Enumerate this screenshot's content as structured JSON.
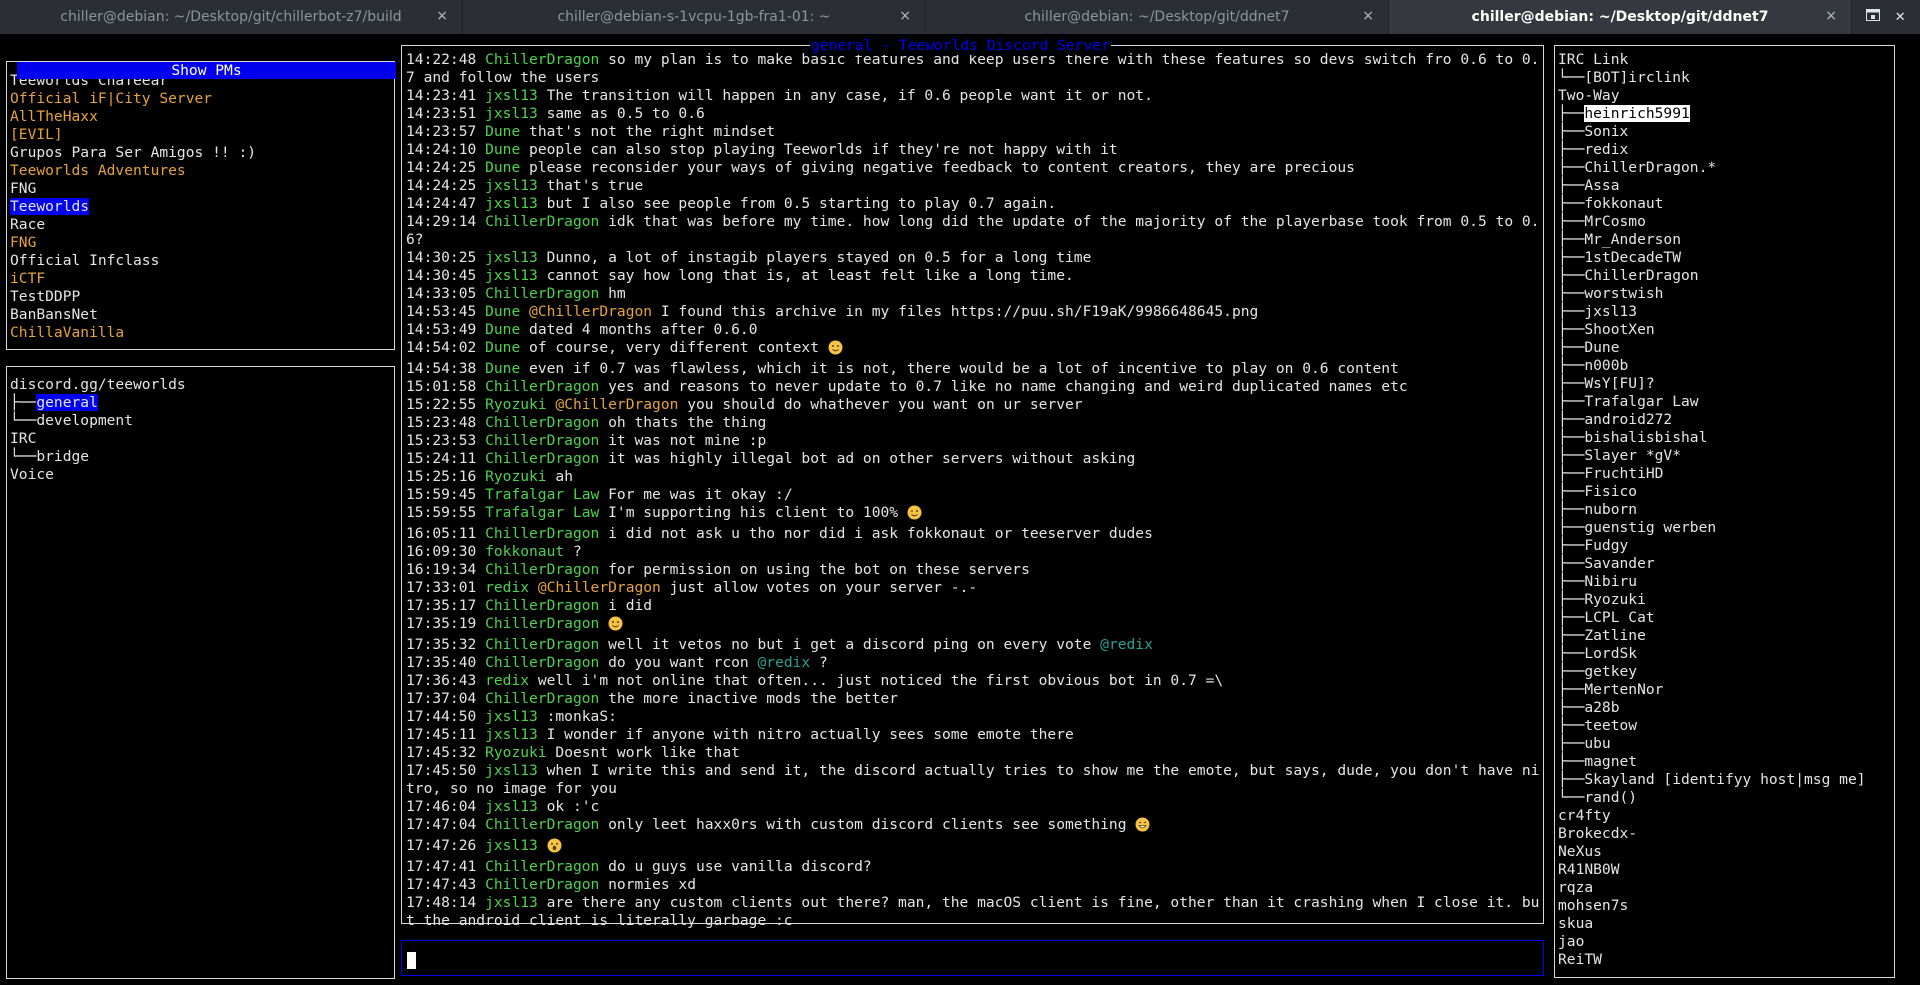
{
  "tabs": [
    {
      "title": "chiller@debian: ~/Desktop/git/chillerbot-z7/build",
      "active": false
    },
    {
      "title": "chiller@debian-s-1vcpu-1gb-fra1-01: ~",
      "active": false
    },
    {
      "title": "chiller@debian: ~/Desktop/git/ddnet7",
      "active": false
    },
    {
      "title": "chiller@debian: ~/Desktop/git/ddnet7",
      "active": true
    }
  ],
  "tab_close_glyph": "×",
  "tab_tools": {
    "new_tab_icon": "new-tab-icon",
    "menu_icon": "menu-icon",
    "close_glyph": "✕"
  },
  "servers": {
    "show_pms_label": "Show PMs",
    "items": [
      {
        "name": "Teeworlds ChaTeear",
        "color": "#e5e5e5"
      },
      {
        "name": "Official iF|City Server",
        "color": "#e6a23c"
      },
      {
        "name": "AllTheHaxx",
        "color": "#e6a23c"
      },
      {
        "name": "[EVIL]",
        "color": "#e6a23c"
      },
      {
        "name": "Grupos Para Ser Amigos !! :)",
        "color": "#e5e5e5"
      },
      {
        "name": "Teeworlds Adventures",
        "color": "#e6a23c"
      },
      {
        "name": "FNG",
        "color": "#e5e5e5"
      },
      {
        "name": "Teeworlds",
        "color": "#0000ee",
        "selected": true
      },
      {
        "name": "Race",
        "color": "#e5e5e5"
      },
      {
        "name": "FNG",
        "color": "#e6a23c"
      },
      {
        "name": "Official Infclass",
        "color": "#e5e5e5"
      },
      {
        "name": "iCTF",
        "color": "#e6a23c"
      },
      {
        "name": "TestDDPP",
        "color": "#e5e5e5"
      },
      {
        "name": "BanBansNet",
        "color": "#e5e5e5"
      },
      {
        "name": "ChillaVanilla",
        "color": "#e6a23c"
      }
    ]
  },
  "channels": {
    "lines": [
      {
        "prefix": "",
        "text": "discord.gg/teeworlds",
        "selected": false
      },
      {
        "prefix": "├──",
        "text": "general",
        "selected": true
      },
      {
        "prefix": "└──",
        "text": "development",
        "selected": false
      },
      {
        "prefix": "",
        "text": "IRC",
        "selected": false
      },
      {
        "prefix": "└──",
        "text": "bridge",
        "selected": false
      },
      {
        "prefix": "",
        "text": "Voice",
        "selected": false
      }
    ]
  },
  "chat": {
    "title": "general - Teeworlds Discord Server",
    "messages": [
      {
        "time": "14:22:48",
        "nick": "ChillerDragon",
        "nick_color": "green",
        "parts": [
          {
            "t": "so my plan is to make basic features and keep users there with these features so devs switch fro 0.6 to 0.7 and follow the users"
          }
        ]
      },
      {
        "time": "14:23:41",
        "nick": "jxsl13",
        "nick_color": "green",
        "parts": [
          {
            "t": "The transition will happen in any case, if 0.6 people want it or not."
          }
        ]
      },
      {
        "time": "14:23:51",
        "nick": "jxsl13",
        "nick_color": "green",
        "parts": [
          {
            "t": "same as 0.5 to 0.6"
          }
        ]
      },
      {
        "time": "14:23:57",
        "nick": "Dune",
        "nick_color": "green",
        "parts": [
          {
            "t": "that's not the right mindset"
          }
        ]
      },
      {
        "time": "14:24:10",
        "nick": "Dune",
        "nick_color": "green",
        "parts": [
          {
            "t": "people can also stop playing Teeworlds if they're not happy with it"
          }
        ]
      },
      {
        "time": "14:24:25",
        "nick": "Dune",
        "nick_color": "green",
        "parts": [
          {
            "t": "please reconsider your ways of giving negative feedback to content creators, they are precious"
          }
        ]
      },
      {
        "time": "14:24:25",
        "nick": "jxsl13",
        "nick_color": "green",
        "parts": [
          {
            "t": "that's true"
          }
        ]
      },
      {
        "time": "14:24:47",
        "nick": "jxsl13",
        "nick_color": "green",
        "parts": [
          {
            "t": "but I also see people from 0.5 starting to play 0.7 again."
          }
        ]
      },
      {
        "time": "14:29:14",
        "nick": "ChillerDragon",
        "nick_color": "green",
        "parts": [
          {
            "t": "idk that was before my time. how long did the update of the majority of the playerbase took from 0.5 to 0.6?"
          }
        ]
      },
      {
        "time": "14:30:25",
        "nick": "jxsl13",
        "nick_color": "green",
        "parts": [
          {
            "t": "Dunno, a lot of instagib players stayed on 0.5 for a long time"
          }
        ]
      },
      {
        "time": "14:30:45",
        "nick": "jxsl13",
        "nick_color": "green",
        "parts": [
          {
            "t": "cannot say how long that is, at least felt like a long time."
          }
        ]
      },
      {
        "time": "14:33:05",
        "nick": "ChillerDragon",
        "nick_color": "green",
        "parts": [
          {
            "t": "hm"
          }
        ]
      },
      {
        "time": "14:53:45",
        "nick": "Dune",
        "nick_color": "green",
        "parts": [
          {
            "t": "@ChillerDragon",
            "c": "mention"
          },
          {
            "t": " I found this archive in my files https://puu.sh/F19aK/9986648645.png"
          }
        ]
      },
      {
        "time": "14:53:49",
        "nick": "Dune",
        "nick_color": "green",
        "parts": [
          {
            "t": "dated 4 months after 0.6.0"
          }
        ]
      },
      {
        "time": "14:54:02",
        "nick": "Dune",
        "nick_color": "green",
        "parts": [
          {
            "t": "of course, very different context "
          },
          {
            "e": "slight-smile-emoji"
          }
        ]
      },
      {
        "time": "14:54:38",
        "nick": "Dune",
        "nick_color": "green",
        "parts": [
          {
            "t": "even if 0.7 was flawless, which it is not, there would be a lot of incentive to play on 0.6 content"
          }
        ]
      },
      {
        "time": "15:01:58",
        "nick": "ChillerDragon",
        "nick_color": "green",
        "parts": [
          {
            "t": "yes and reasons to never update to 0.7 like no name changing and weird duplicated names etc"
          }
        ]
      },
      {
        "time": "15:22:55",
        "nick": "Ryozuki",
        "nick_color": "green",
        "parts": [
          {
            "t": "@ChillerDragon",
            "c": "mention"
          },
          {
            "t": " you should do whathever you want on ur server"
          }
        ]
      },
      {
        "time": "15:23:48",
        "nick": "ChillerDragon",
        "nick_color": "green",
        "parts": [
          {
            "t": "oh thats the thing"
          }
        ]
      },
      {
        "time": "15:23:53",
        "nick": "ChillerDragon",
        "nick_color": "green",
        "parts": [
          {
            "t": "it was not mine :p"
          }
        ]
      },
      {
        "time": "15:24:11",
        "nick": "ChillerDragon",
        "nick_color": "green",
        "parts": [
          {
            "t": "it was highly illegal bot ad on other servers without asking"
          }
        ]
      },
      {
        "time": "15:25:16",
        "nick": "Ryozuki",
        "nick_color": "green",
        "parts": [
          {
            "t": "ah"
          }
        ]
      },
      {
        "time": "15:59:45",
        "nick": "Trafalgar Law",
        "nick_color": "green",
        "parts": [
          {
            "t": "For me was it okay :/"
          }
        ]
      },
      {
        "time": "15:59:55",
        "nick": "Trafalgar Law",
        "nick_color": "green",
        "parts": [
          {
            "t": "I'm supporting his client to 100% "
          },
          {
            "e": "wink-emoji"
          }
        ]
      },
      {
        "time": "16:05:11",
        "nick": "ChillerDragon",
        "nick_color": "green",
        "parts": [
          {
            "t": "i did not ask u tho nor did i ask fokkonaut or teeserver dudes"
          }
        ]
      },
      {
        "time": "16:09:30",
        "nick": "fokkonaut",
        "nick_color": "green",
        "parts": [
          {
            "t": "?"
          }
        ]
      },
      {
        "time": "16:19:34",
        "nick": "ChillerDragon",
        "nick_color": "green",
        "parts": [
          {
            "t": "for permission on using the bot on these servers"
          }
        ]
      },
      {
        "time": "17:33:01",
        "nick": "redix",
        "nick_color": "green",
        "parts": [
          {
            "t": "@ChillerDragon",
            "c": "mention"
          },
          {
            "t": " just allow votes on your server -.-"
          }
        ]
      },
      {
        "time": "17:35:17",
        "nick": "ChillerDragon",
        "nick_color": "green",
        "parts": [
          {
            "t": "i did"
          }
        ]
      },
      {
        "time": "17:35:19",
        "nick": "ChillerDragon",
        "nick_color": "green",
        "parts": [
          {
            "e": "slight-smile-emoji"
          }
        ]
      },
      {
        "time": "17:35:32",
        "nick": "ChillerDragon",
        "nick_color": "green",
        "parts": [
          {
            "t": "well it vetos no but i get a discord ping on every vote "
          },
          {
            "t": "@redix",
            "c": "mention-teal"
          }
        ]
      },
      {
        "time": "17:35:40",
        "nick": "ChillerDragon",
        "nick_color": "green",
        "parts": [
          {
            "t": "do you want rcon "
          },
          {
            "t": "@redix",
            "c": "mention-teal"
          },
          {
            "t": " ?"
          }
        ]
      },
      {
        "time": "17:36:43",
        "nick": "redix",
        "nick_color": "green",
        "parts": [
          {
            "t": "well i'm not online that often... just noticed the first obvious bot in 0.7 =\\"
          }
        ]
      },
      {
        "time": "17:37:04",
        "nick": "ChillerDragon",
        "nick_color": "green",
        "parts": [
          {
            "t": "the more inactive mods the better"
          }
        ]
      },
      {
        "time": "17:44:50",
        "nick": "jxsl13",
        "nick_color": "green",
        "parts": [
          {
            "t": ":monkaS:"
          }
        ]
      },
      {
        "time": "17:45:11",
        "nick": "jxsl13",
        "nick_color": "green",
        "parts": [
          {
            "t": "I wonder if anyone with nitro actually sees some emote there"
          }
        ]
      },
      {
        "time": "17:45:32",
        "nick": "Ryozuki",
        "nick_color": "green",
        "parts": [
          {
            "t": "Doesnt work like that"
          }
        ]
      },
      {
        "time": "17:45:50",
        "nick": "jxsl13",
        "nick_color": "green",
        "parts": [
          {
            "t": "when I write this and send it, the discord actually tries to show me the emote, but says, dude, you don't have nitro, so no image for you"
          }
        ]
      },
      {
        "time": "17:46:04",
        "nick": "jxsl13",
        "nick_color": "green",
        "parts": [
          {
            "t": "ok :'c"
          }
        ]
      },
      {
        "time": "17:47:04",
        "nick": "ChillerDragon",
        "nick_color": "green",
        "parts": [
          {
            "t": "only leet haxx0rs with custom discord clients see something "
          },
          {
            "e": "grin-emoji"
          }
        ]
      },
      {
        "time": "17:47:26",
        "nick": "jxsl13",
        "nick_color": "green",
        "parts": [
          {
            "e": "open-mouth-emoji"
          }
        ]
      },
      {
        "time": "17:47:41",
        "nick": "ChillerDragon",
        "nick_color": "green",
        "parts": [
          {
            "t": "do u guys use vanilla discord?"
          }
        ]
      },
      {
        "time": "17:47:43",
        "nick": "ChillerDragon",
        "nick_color": "green",
        "parts": [
          {
            "t": "normies xd"
          }
        ]
      },
      {
        "time": "17:48:14",
        "nick": "jxsl13",
        "nick_color": "green",
        "parts": [
          {
            "t": "are there any custom clients out there? man, the macOS client is fine, other than it crashing when I close it. but the android client is literally garbage :c"
          }
        ]
      }
    ]
  },
  "input": {
    "value": ""
  },
  "users": {
    "lines": [
      {
        "prefix": "",
        "text": "IRC Link"
      },
      {
        "prefix": "└──",
        "text": "[BOT]irclink"
      },
      {
        "prefix": "",
        "text": "Two-Way"
      },
      {
        "prefix": "├──",
        "text": "heinrich5991",
        "highlight": true
      },
      {
        "prefix": "├──",
        "text": "Sonix"
      },
      {
        "prefix": "├──",
        "text": "redix"
      },
      {
        "prefix": "├──",
        "text": "ChillerDragon.*"
      },
      {
        "prefix": "├──",
        "text": "Assa"
      },
      {
        "prefix": "├──",
        "text": "fokkonaut"
      },
      {
        "prefix": "├──",
        "text": "MrCosmo"
      },
      {
        "prefix": "├──",
        "text": "Mr_Anderson"
      },
      {
        "prefix": "├──",
        "text": "1stDecadeTW"
      },
      {
        "prefix": "├──",
        "text": "ChillerDragon"
      },
      {
        "prefix": "├──",
        "text": "worstwish"
      },
      {
        "prefix": "├──",
        "text": "jxsl13"
      },
      {
        "prefix": "├──",
        "text": "ShootXen"
      },
      {
        "prefix": "├──",
        "text": "Dune"
      },
      {
        "prefix": "├──",
        "text": "n000b"
      },
      {
        "prefix": "├──",
        "text": "WsY[FU]?"
      },
      {
        "prefix": "├──",
        "text": "Trafalgar Law"
      },
      {
        "prefix": "├──",
        "text": "android272"
      },
      {
        "prefix": "├──",
        "text": "bishalisbishal"
      },
      {
        "prefix": "├──",
        "text": "Slayer *gV*"
      },
      {
        "prefix": "├──",
        "text": "FruchtiHD"
      },
      {
        "prefix": "├──",
        "text": "Fisico"
      },
      {
        "prefix": "├──",
        "text": "nuborn"
      },
      {
        "prefix": "├──",
        "text": "guenstig werben"
      },
      {
        "prefix": "├──",
        "text": "Fudgy"
      },
      {
        "prefix": "├──",
        "text": "Savander"
      },
      {
        "prefix": "├──",
        "text": "Nibiru"
      },
      {
        "prefix": "├──",
        "text": "Ryozuki"
      },
      {
        "prefix": "├──",
        "text": "LCPL Cat"
      },
      {
        "prefix": "├──",
        "text": "Zatline"
      },
      {
        "prefix": "├──",
        "text": "LordSk"
      },
      {
        "prefix": "├──",
        "text": "getkey"
      },
      {
        "prefix": "├──",
        "text": "MertenNor"
      },
      {
        "prefix": "├──",
        "text": "a28b"
      },
      {
        "prefix": "├──",
        "text": "teetow"
      },
      {
        "prefix": "├──",
        "text": "ubu"
      },
      {
        "prefix": "├──",
        "text": "magnet"
      },
      {
        "prefix": "├──",
        "text": "Skayland [identifyy host|msg me]"
      },
      {
        "prefix": "└──",
        "text": "rand()"
      },
      {
        "prefix": "",
        "text": "cr4fty"
      },
      {
        "prefix": "",
        "text": "Brokecdx-"
      },
      {
        "prefix": "",
        "text": "NeXus"
      },
      {
        "prefix": "",
        "text": "R41NB0W"
      },
      {
        "prefix": "",
        "text": "rqza"
      },
      {
        "prefix": "",
        "text": "mohsen7s"
      },
      {
        "prefix": "",
        "text": "skua"
      },
      {
        "prefix": "",
        "text": "jao"
      },
      {
        "prefix": "",
        "text": "ReiTW"
      }
    ]
  },
  "colors": {
    "green": "#4dd24d",
    "orange": "#e6a23c",
    "teal": "#2aa198",
    "blue": "#0000ee"
  }
}
